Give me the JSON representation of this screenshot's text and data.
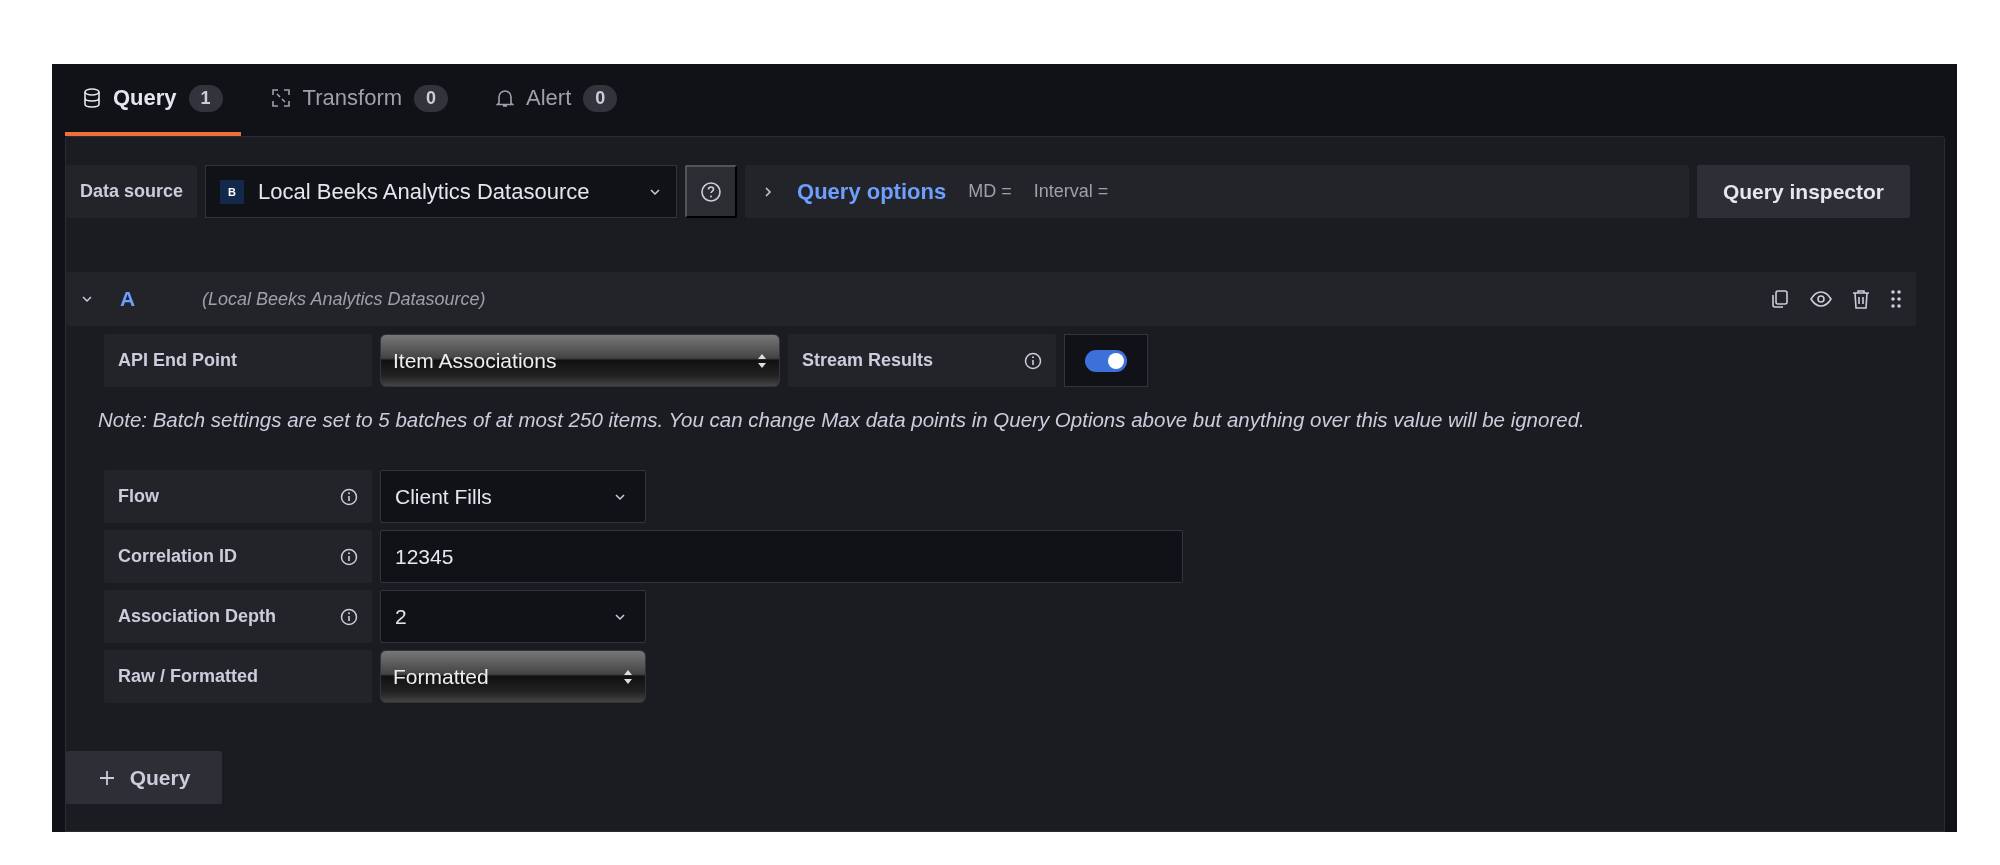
{
  "tabs": [
    {
      "label": "Query",
      "count": "1",
      "selected": true,
      "kind": "database"
    },
    {
      "label": "Transform",
      "count": "0",
      "selected": false,
      "kind": "transform"
    },
    {
      "label": "Alert",
      "count": "0",
      "selected": false,
      "kind": "bell"
    }
  ],
  "datasource": {
    "label": "Data source",
    "logo": "B",
    "value": "Local Beeks Analytics Datasource"
  },
  "query_options": {
    "title": "Query options",
    "expanded": false,
    "md": "MD =",
    "interval": "Interval ="
  },
  "inspector_button": "Query inspector",
  "query": {
    "letter": "A",
    "source": "(Local Beeks Analytics Datasource)",
    "expanded": true,
    "api_label": "API End Point",
    "api_value": "Item Associations",
    "stream_label": "Stream Results",
    "stream_on": true,
    "note": "Note: Batch settings are set to 5 batches of at most 250 items. You can change Max data points in Query Options above but anything over this value will be ignored.",
    "fields": [
      {
        "label": "Flow",
        "info": true,
        "kind": "dropdown",
        "value": "Client Fills"
      },
      {
        "label": "Correlation ID",
        "info": true,
        "kind": "input",
        "value": "12345"
      },
      {
        "label": "Association Depth",
        "info": true,
        "kind": "dropdown",
        "value": "2"
      },
      {
        "label": "Raw / Formatted",
        "info": false,
        "kind": "native",
        "value": "Formatted"
      }
    ]
  },
  "add_query_button": "Query"
}
